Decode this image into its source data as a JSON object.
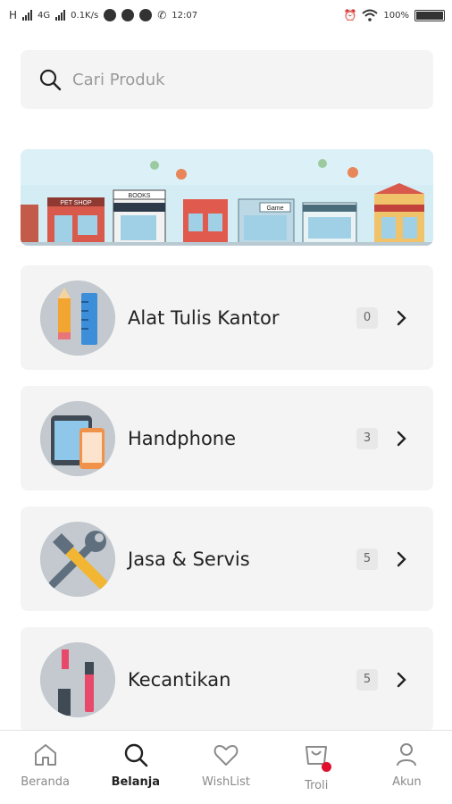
{
  "status_bar": {
    "carrier_h": "H",
    "network": "4G",
    "speed": "0.1K/s",
    "time": "12:07",
    "battery": "100%"
  },
  "search": {
    "placeholder": "Cari Produk",
    "icon": "search-icon"
  },
  "banner": {
    "shop_signs": [
      "PET SHOP",
      "BOOKS",
      "Game"
    ]
  },
  "categories": [
    {
      "label": "Alat Tulis Kantor",
      "count": "0",
      "icon": "stationery-icon"
    },
    {
      "label": "Handphone",
      "count": "3",
      "icon": "phone-icon"
    },
    {
      "label": "Jasa & Servis",
      "count": "5",
      "icon": "tools-icon"
    },
    {
      "label": "Kecantikan",
      "count": "5",
      "icon": "cosmetics-icon"
    }
  ],
  "bottom_nav": [
    {
      "label": "Beranda",
      "icon": "home-icon",
      "active": false
    },
    {
      "label": "Belanja",
      "icon": "search-icon",
      "active": true
    },
    {
      "label": "WishList",
      "icon": "heart-icon",
      "active": false
    },
    {
      "label": "Troli",
      "icon": "cart-icon",
      "active": false
    },
    {
      "label": "Akun",
      "icon": "user-icon",
      "active": false
    }
  ],
  "colors": {
    "accent": "#e0102e",
    "card_bg": "#f4f4f4",
    "banner_sky": "#d9f0f6"
  }
}
